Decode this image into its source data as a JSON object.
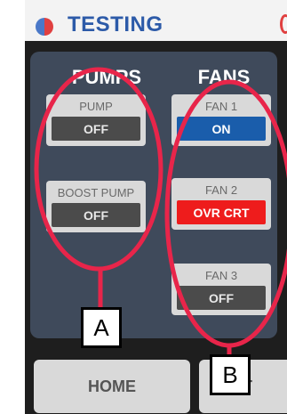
{
  "header": {
    "title": "TESTING"
  },
  "columns": {
    "pumps": {
      "heading": "PUMPS",
      "tiles": [
        {
          "label": "PUMP",
          "value": "OFF",
          "state": "off"
        },
        {
          "label": "BOOST PUMP",
          "value": "OFF",
          "state": "off"
        }
      ]
    },
    "fans": {
      "heading": "FANS",
      "tiles": [
        {
          "label": "FAN 1",
          "value": "ON",
          "state": "on"
        },
        {
          "label": "FAN 2",
          "value": "OVR CRT",
          "state": "alert"
        },
        {
          "label": "FAN 3",
          "value": "OFF",
          "state": "off"
        }
      ]
    }
  },
  "nav": {
    "home_label": "HOME",
    "next_label": "NEXT"
  },
  "callouts": {
    "a_label": "A",
    "b_label": "B"
  },
  "colors": {
    "on": "#1a5dab",
    "alert": "#ee1c1c",
    "callout_outline": "#e8254a"
  }
}
